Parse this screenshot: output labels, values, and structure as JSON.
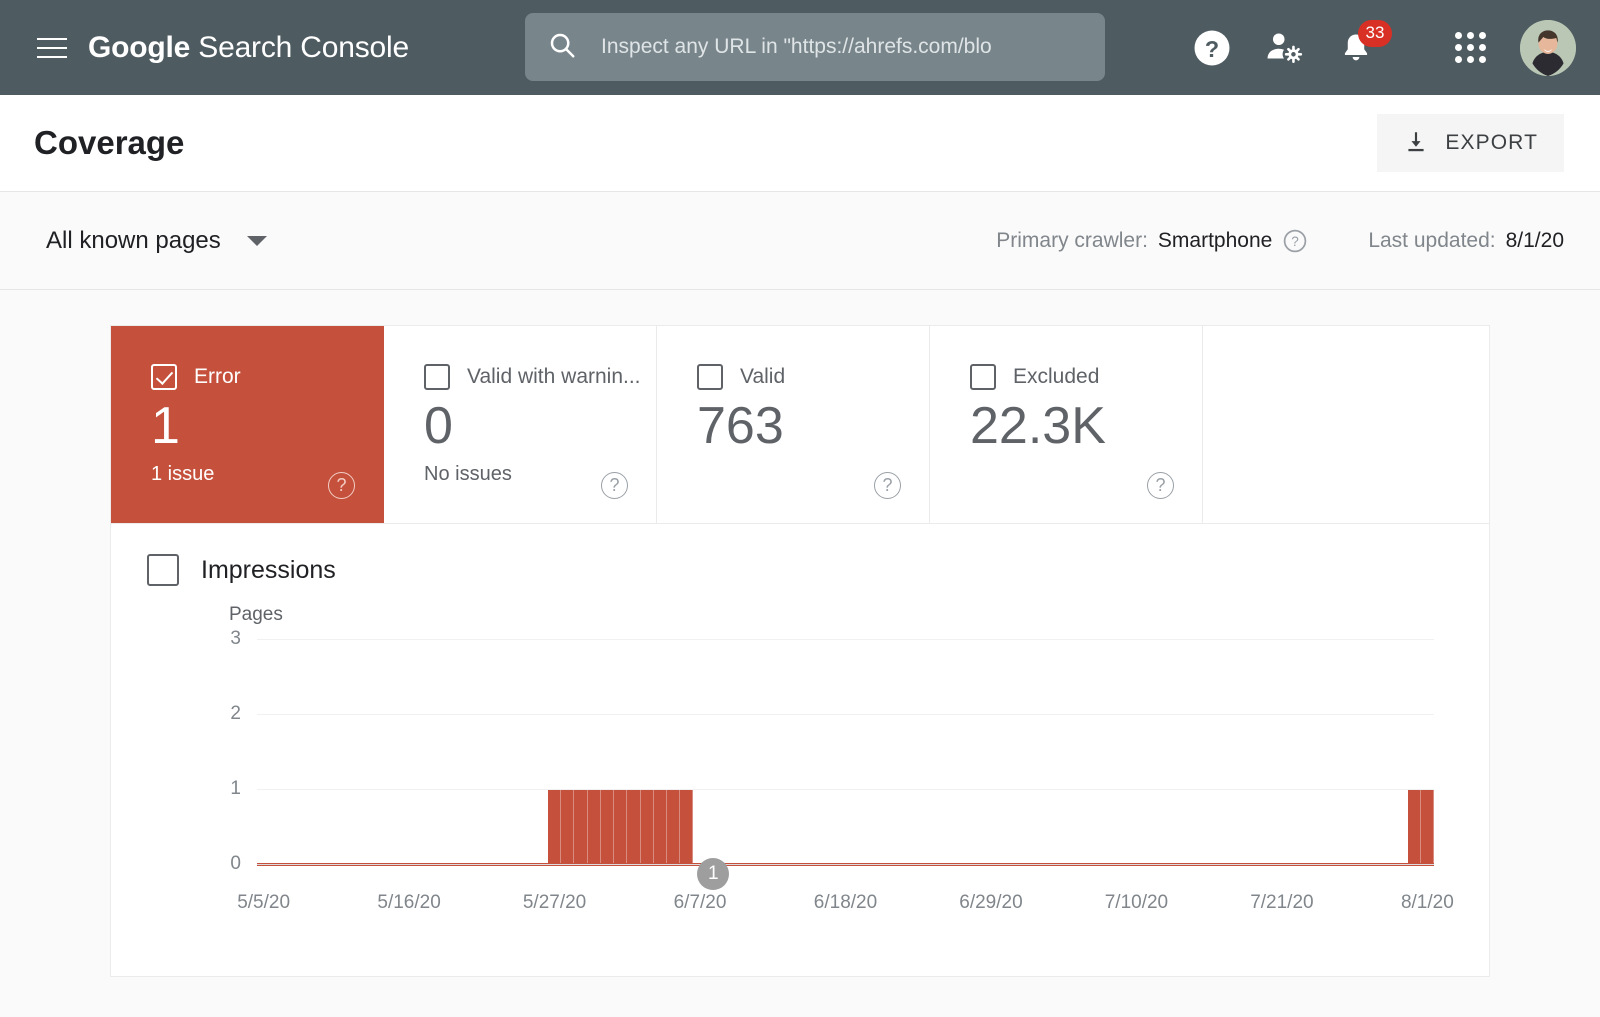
{
  "header": {
    "menu_icon": "hamburger-menu-icon",
    "brand_strong": "Google",
    "brand_light": " Search Console",
    "search": {
      "icon": "search-icon",
      "placeholder": "Inspect any URL in \"https://ahrefs.com/blo"
    },
    "help_icon": "help-icon",
    "account_settings_icon": "account-settings-icon",
    "notifications_icon": "notification-bell-icon",
    "notification_count": "33",
    "apps_icon": "apps-grid-icon",
    "avatar": "user-avatar",
    "bg_color": "#4e5b61",
    "search_bg_color": "#78868c",
    "badge_color": "#d93025"
  },
  "titlebar": {
    "title": "Coverage",
    "export_label": "EXPORT",
    "export_icon": "download-icon"
  },
  "filterbar": {
    "page_filter": "All known pages",
    "caret_icon": "chevron-down-icon",
    "crawler_prefix": "Primary crawler:",
    "crawler_value": "Smartphone",
    "crawler_help_icon": "help-icon",
    "updated_prefix": "Last updated:",
    "updated_value": "8/1/20"
  },
  "cards": [
    {
      "label": "Error",
      "value": "1",
      "sub": "1 issue",
      "checked": true,
      "active": true,
      "help_icon": "help-icon"
    },
    {
      "label": "Valid with warnin...",
      "value": "0",
      "sub": "No issues",
      "checked": false,
      "active": false,
      "help_icon": "help-icon"
    },
    {
      "label": "Valid",
      "value": "763",
      "sub": "",
      "checked": false,
      "active": false,
      "help_icon": "help-icon"
    },
    {
      "label": "Excluded",
      "value": "22.3K",
      "sub": "",
      "checked": false,
      "active": false,
      "help_icon": "help-icon"
    }
  ],
  "impressions": {
    "label": "Impressions",
    "checked": false
  },
  "colors": {
    "error_red": "#c5513c",
    "text_primary": "#202124",
    "text_secondary": "#5f6368",
    "text_muted": "#80868b",
    "panel_bg": "#ffffff",
    "page_bg": "#fafafa"
  },
  "chart_data": {
    "type": "bar",
    "title": "",
    "ylabel": "Pages",
    "xlabel": "",
    "ylim": [
      0,
      3
    ],
    "yticks": [
      0,
      1,
      2,
      3
    ],
    "grid": true,
    "legend": "none",
    "series": [
      {
        "name": "Error",
        "color": "#c5513c",
        "values": [
          0,
          0,
          0,
          0,
          0,
          0,
          0,
          0,
          0,
          0,
          0,
          0,
          0,
          0,
          0,
          0,
          0,
          0,
          0,
          0,
          0,
          0,
          1,
          1,
          1,
          1,
          1,
          1,
          1,
          1,
          1,
          1,
          1,
          0,
          0,
          0,
          0,
          0,
          0,
          0,
          0,
          0,
          0,
          0,
          0,
          0,
          0,
          0,
          0,
          0,
          0,
          0,
          0,
          0,
          0,
          0,
          0,
          0,
          0,
          0,
          0,
          0,
          0,
          0,
          0,
          0,
          0,
          0,
          0,
          0,
          0,
          0,
          0,
          0,
          0,
          0,
          0,
          0,
          0,
          0,
          0,
          0,
          0,
          0,
          0,
          0,
          0,
          1,
          1
        ]
      }
    ],
    "xtick_labels": [
      "5/5/20",
      "5/16/20",
      "5/27/20",
      "6/7/20",
      "6/18/20",
      "6/29/20",
      "7/10/20",
      "7/21/20",
      "8/1/20"
    ],
    "xtick_positions": [
      0,
      11,
      22,
      33,
      44,
      55,
      66,
      77,
      88
    ],
    "annotations": [
      {
        "label": "1",
        "index": 34
      }
    ]
  }
}
